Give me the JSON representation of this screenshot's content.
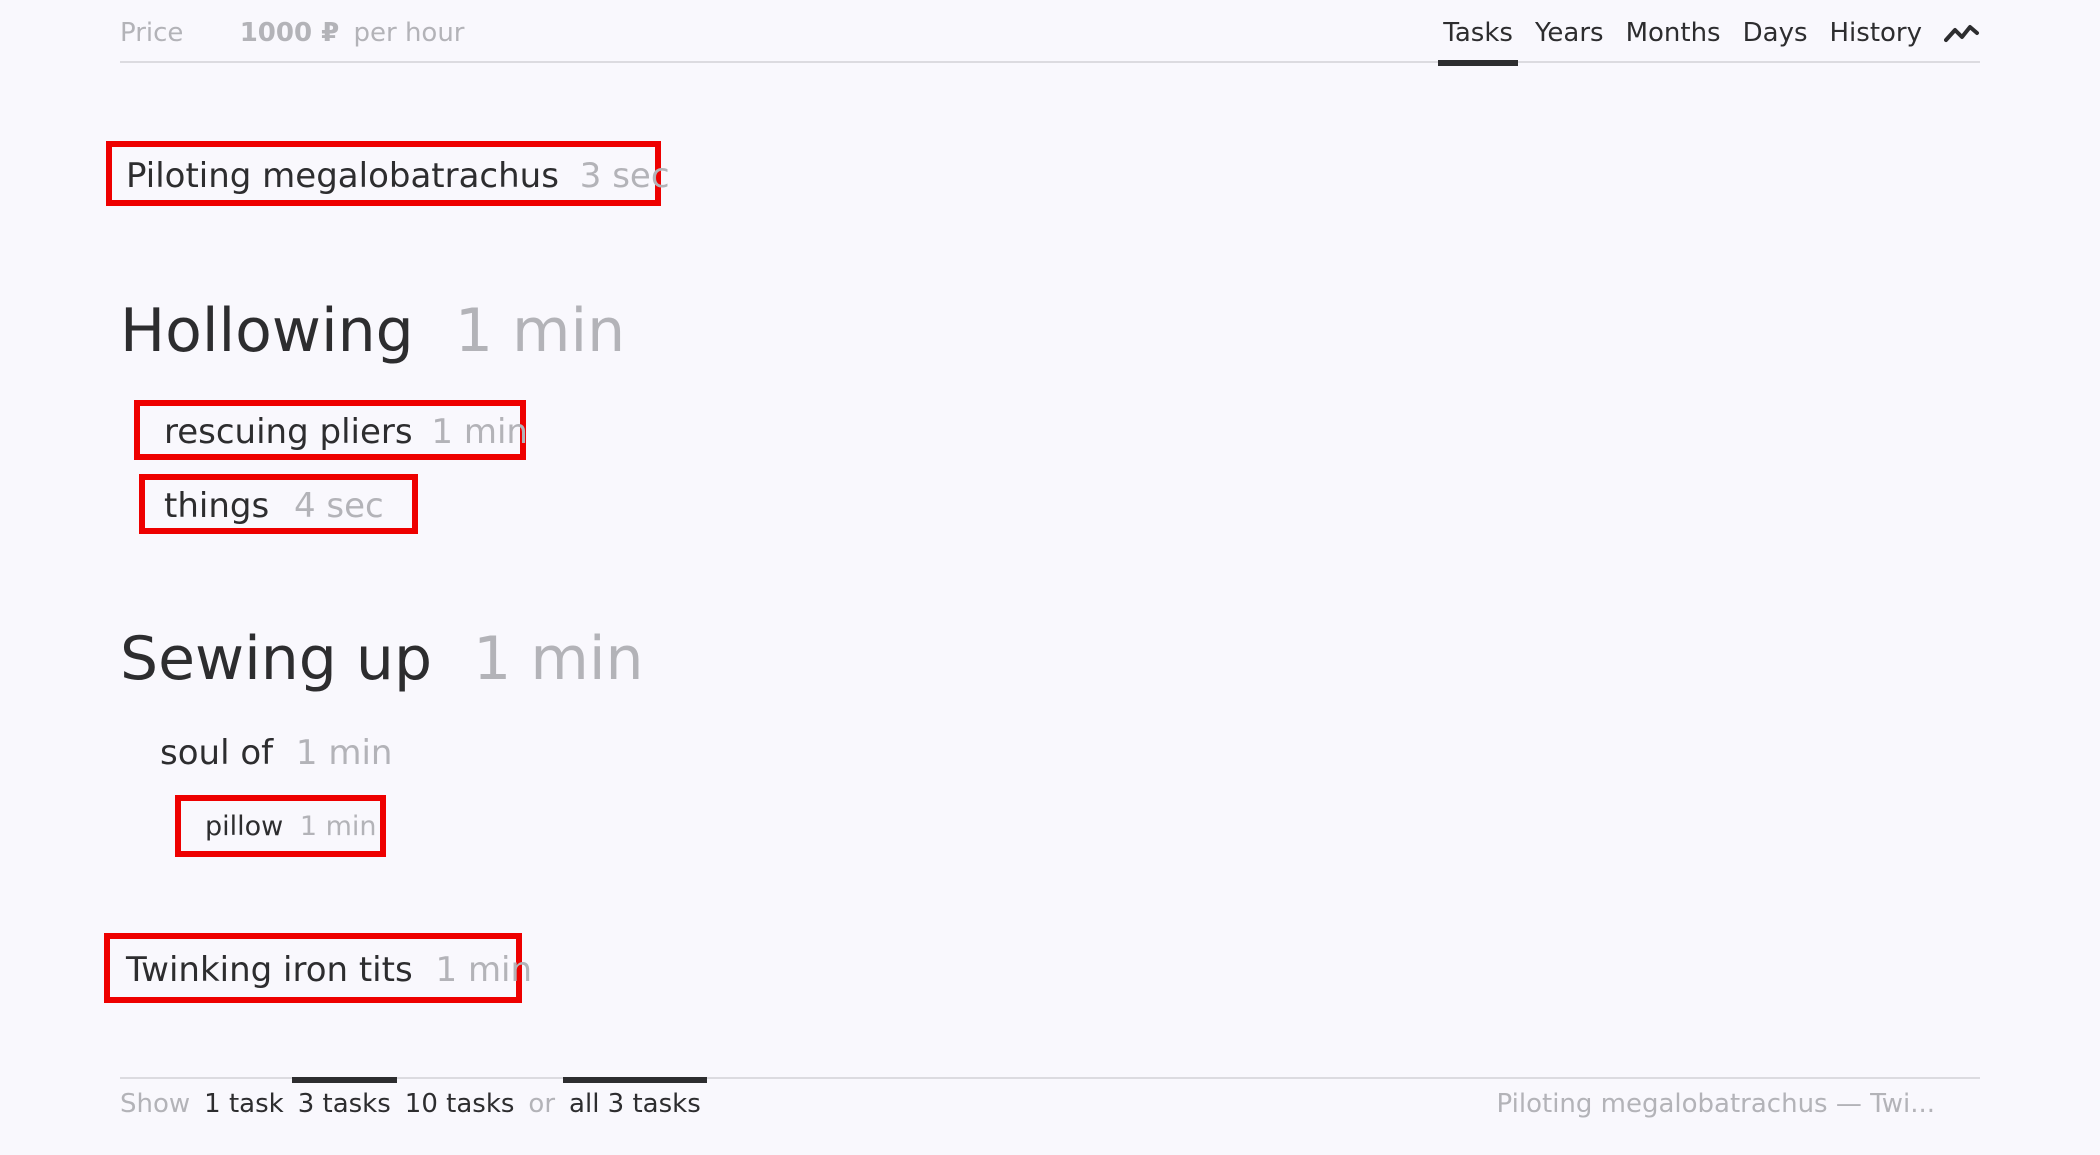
{
  "header": {
    "price_label": "Price",
    "price_amount": "1000 ₽",
    "price_unit": "per hour",
    "tabs": [
      {
        "label": "Tasks",
        "active": true
      },
      {
        "label": "Years",
        "active": false
      },
      {
        "label": "Months",
        "active": false
      },
      {
        "label": "Days",
        "active": false
      },
      {
        "label": "History",
        "active": false
      }
    ],
    "chart_icon": "trend-line-icon"
  },
  "items": {
    "piloting": {
      "name": "Piloting megalobatrachus",
      "duration": "3 sec"
    },
    "hollowing": {
      "name": "Hollowing",
      "duration": "1 min"
    },
    "rescuing": {
      "name": "rescuing pliers",
      "duration": "1 min"
    },
    "things": {
      "name": "things",
      "duration": "4 sec"
    },
    "sewing": {
      "name": "Sewing up",
      "duration": "1 min"
    },
    "soul": {
      "name": "soul of",
      "duration": "1 min"
    },
    "pillow": {
      "name": "pillow",
      "duration": "1 min"
    },
    "twinking": {
      "name": "Twinking iron tits",
      "duration": "1 min"
    }
  },
  "footer": {
    "show_label": "Show",
    "opt1": "1 task",
    "opt2": "3 tasks",
    "opt3": "10 tasks",
    "or_label": "or",
    "opt_all": "all 3 tasks",
    "summary": "Piloting megalobatrachus — Twi..."
  },
  "colors": {
    "highlight": "#ee0000",
    "text": "#2d2d2f",
    "muted": "#b3b3b8"
  }
}
